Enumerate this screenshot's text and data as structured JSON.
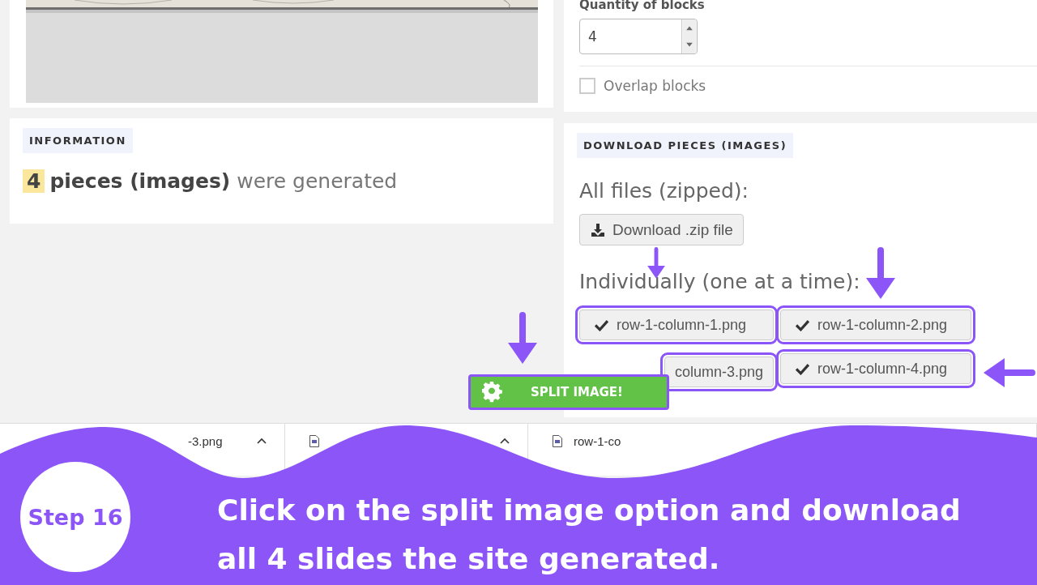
{
  "settings": {
    "quantity_label": "Quantity of blocks",
    "quantity_value": "4",
    "overlap": {
      "label": "Overlap blocks",
      "checked": false
    }
  },
  "information": {
    "heading": "INFORMATION",
    "count": "4",
    "message": "**pieces (images)** were generated"
  },
  "downloads": {
    "heading": "DOWNLOAD PIECES (IMAGES)",
    "zipped_label": "All files (zipped):",
    "zip_button": "Download .zip file",
    "individual_label": "Individually (one at a time):",
    "files": [
      {
        "label": "row-1-column-1.png",
        "check_icon": true
      },
      {
        "label": "row-1-column-2.png",
        "check_icon": true
      },
      {
        "label": "column-3.png",
        "check_icon": false
      },
      {
        "label": "row-1-column-4.png",
        "check_icon": true
      }
    ]
  },
  "split_button": "SPLIT IMAGE!",
  "download_bar": [
    {
      "label": "-3.png",
      "file_icon": false,
      "chevron": true
    },
    {
      "file_icon": true,
      "chevron": true
    },
    {
      "label": "row-1-co",
      "file_icon": true,
      "chevron": false
    }
  ],
  "banner": {
    "step": "Step 16",
    "instruction": "Click on the split image option and download all 4 slides the site generated."
  }
}
